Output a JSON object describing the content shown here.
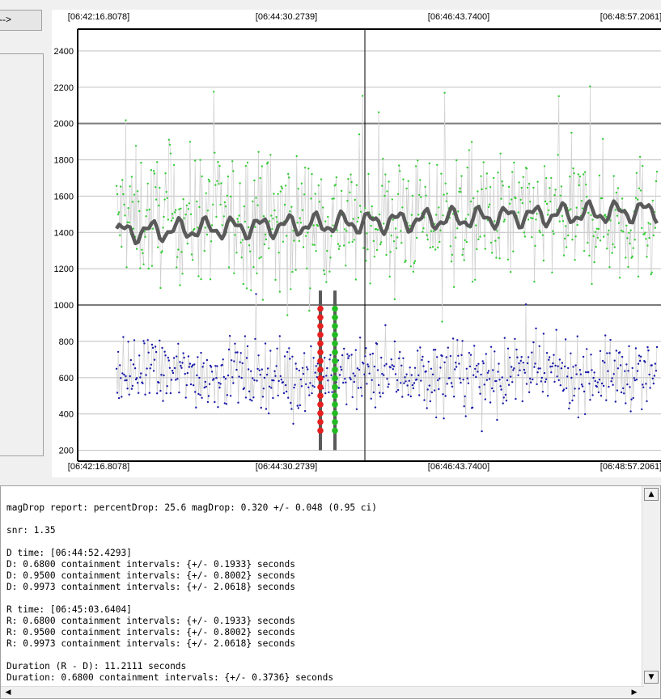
{
  "toolbar": {
    "arrow_label": "-->"
  },
  "chart_data": {
    "type": "scatter",
    "xticks": [
      "[06:42:16.8078]",
      "[06:44:30.2739]",
      "[06:46:43.7400]",
      "[06:48:57.2061]"
    ],
    "yticks": [
      200,
      400,
      600,
      800,
      1000,
      1200,
      1400,
      1600,
      1800,
      2000,
      2200,
      2400
    ],
    "ylim": [
      140,
      2520
    ],
    "grid": true,
    "series": [
      {
        "role": "target",
        "color": "#33cc33",
        "mean": 1480,
        "spread": 320,
        "n": 640
      },
      {
        "role": "comparison",
        "color": "#1a1aaa",
        "mean": 620,
        "spread": 170,
        "n": 640
      },
      {
        "role": "smoothed",
        "color": "#5a5a5a"
      }
    ],
    "markers": {
      "D": {
        "color": "#e62020"
      },
      "R": {
        "color": "#22bb22"
      }
    }
  },
  "report": {
    "lines": [
      "magDrop report: percentDrop: 25.6 magDrop: 0.320 +/- 0.048 (0.95 ci)",
      "",
      "snr: 1.35",
      "",
      "D time: [06:44:52.4293]",
      "D: 0.6800 containment intervals: {+/- 0.1933} seconds",
      "D: 0.9500 containment intervals: {+/- 0.8002} seconds",
      "D: 0.9973 containment intervals: {+/- 2.0618} seconds",
      "",
      "R time: [06:45:03.6404]",
      "R: 0.6800 containment intervals: {+/- 0.1933} seconds",
      "R: 0.9500 containment intervals: {+/- 0.8002} seconds",
      "R: 0.9973 containment intervals: {+/- 2.0618} seconds",
      "",
      "Duration (R - D): 11.2111 seconds",
      "Duration: 0.6800 containment intervals: {+/- 0.3736} seconds"
    ]
  },
  "scroll": {
    "up_glyph": "▲",
    "down_glyph": "▼",
    "left_glyph": "◀",
    "right_glyph": "▶"
  }
}
